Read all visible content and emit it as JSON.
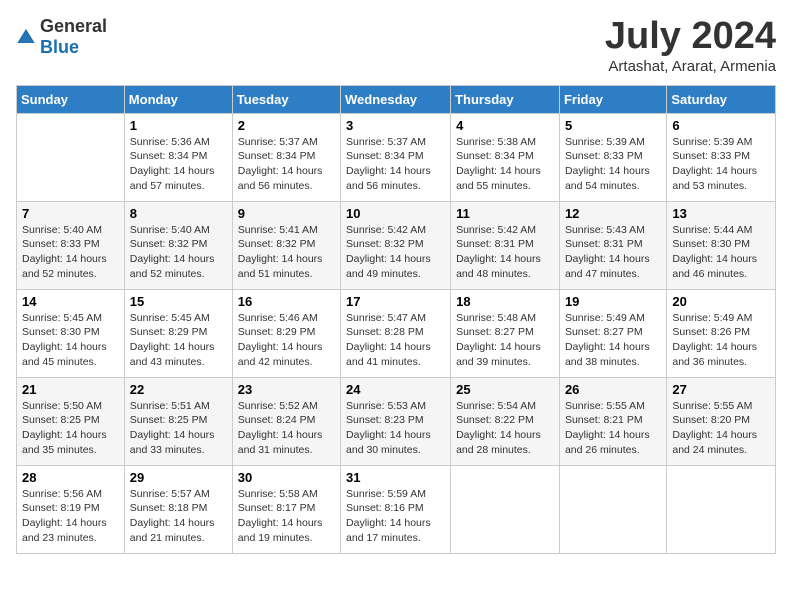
{
  "header": {
    "logo_general": "General",
    "logo_blue": "Blue",
    "month_title": "July 2024",
    "location": "Artashat, Ararat, Armenia"
  },
  "weekdays": [
    "Sunday",
    "Monday",
    "Tuesday",
    "Wednesday",
    "Thursday",
    "Friday",
    "Saturday"
  ],
  "weeks": [
    [
      {
        "day": "",
        "detail": ""
      },
      {
        "day": "1",
        "detail": "Sunrise: 5:36 AM\nSunset: 8:34 PM\nDaylight: 14 hours\nand 57 minutes."
      },
      {
        "day": "2",
        "detail": "Sunrise: 5:37 AM\nSunset: 8:34 PM\nDaylight: 14 hours\nand 56 minutes."
      },
      {
        "day": "3",
        "detail": "Sunrise: 5:37 AM\nSunset: 8:34 PM\nDaylight: 14 hours\nand 56 minutes."
      },
      {
        "day": "4",
        "detail": "Sunrise: 5:38 AM\nSunset: 8:34 PM\nDaylight: 14 hours\nand 55 minutes."
      },
      {
        "day": "5",
        "detail": "Sunrise: 5:39 AM\nSunset: 8:33 PM\nDaylight: 14 hours\nand 54 minutes."
      },
      {
        "day": "6",
        "detail": "Sunrise: 5:39 AM\nSunset: 8:33 PM\nDaylight: 14 hours\nand 53 minutes."
      }
    ],
    [
      {
        "day": "7",
        "detail": "Sunrise: 5:40 AM\nSunset: 8:33 PM\nDaylight: 14 hours\nand 52 minutes."
      },
      {
        "day": "8",
        "detail": "Sunrise: 5:40 AM\nSunset: 8:32 PM\nDaylight: 14 hours\nand 52 minutes."
      },
      {
        "day": "9",
        "detail": "Sunrise: 5:41 AM\nSunset: 8:32 PM\nDaylight: 14 hours\nand 51 minutes."
      },
      {
        "day": "10",
        "detail": "Sunrise: 5:42 AM\nSunset: 8:32 PM\nDaylight: 14 hours\nand 49 minutes."
      },
      {
        "day": "11",
        "detail": "Sunrise: 5:42 AM\nSunset: 8:31 PM\nDaylight: 14 hours\nand 48 minutes."
      },
      {
        "day": "12",
        "detail": "Sunrise: 5:43 AM\nSunset: 8:31 PM\nDaylight: 14 hours\nand 47 minutes."
      },
      {
        "day": "13",
        "detail": "Sunrise: 5:44 AM\nSunset: 8:30 PM\nDaylight: 14 hours\nand 46 minutes."
      }
    ],
    [
      {
        "day": "14",
        "detail": "Sunrise: 5:45 AM\nSunset: 8:30 PM\nDaylight: 14 hours\nand 45 minutes."
      },
      {
        "day": "15",
        "detail": "Sunrise: 5:45 AM\nSunset: 8:29 PM\nDaylight: 14 hours\nand 43 minutes."
      },
      {
        "day": "16",
        "detail": "Sunrise: 5:46 AM\nSunset: 8:29 PM\nDaylight: 14 hours\nand 42 minutes."
      },
      {
        "day": "17",
        "detail": "Sunrise: 5:47 AM\nSunset: 8:28 PM\nDaylight: 14 hours\nand 41 minutes."
      },
      {
        "day": "18",
        "detail": "Sunrise: 5:48 AM\nSunset: 8:27 PM\nDaylight: 14 hours\nand 39 minutes."
      },
      {
        "day": "19",
        "detail": "Sunrise: 5:49 AM\nSunset: 8:27 PM\nDaylight: 14 hours\nand 38 minutes."
      },
      {
        "day": "20",
        "detail": "Sunrise: 5:49 AM\nSunset: 8:26 PM\nDaylight: 14 hours\nand 36 minutes."
      }
    ],
    [
      {
        "day": "21",
        "detail": "Sunrise: 5:50 AM\nSunset: 8:25 PM\nDaylight: 14 hours\nand 35 minutes."
      },
      {
        "day": "22",
        "detail": "Sunrise: 5:51 AM\nSunset: 8:25 PM\nDaylight: 14 hours\nand 33 minutes."
      },
      {
        "day": "23",
        "detail": "Sunrise: 5:52 AM\nSunset: 8:24 PM\nDaylight: 14 hours\nand 31 minutes."
      },
      {
        "day": "24",
        "detail": "Sunrise: 5:53 AM\nSunset: 8:23 PM\nDaylight: 14 hours\nand 30 minutes."
      },
      {
        "day": "25",
        "detail": "Sunrise: 5:54 AM\nSunset: 8:22 PM\nDaylight: 14 hours\nand 28 minutes."
      },
      {
        "day": "26",
        "detail": "Sunrise: 5:55 AM\nSunset: 8:21 PM\nDaylight: 14 hours\nand 26 minutes."
      },
      {
        "day": "27",
        "detail": "Sunrise: 5:55 AM\nSunset: 8:20 PM\nDaylight: 14 hours\nand 24 minutes."
      }
    ],
    [
      {
        "day": "28",
        "detail": "Sunrise: 5:56 AM\nSunset: 8:19 PM\nDaylight: 14 hours\nand 23 minutes."
      },
      {
        "day": "29",
        "detail": "Sunrise: 5:57 AM\nSunset: 8:18 PM\nDaylight: 14 hours\nand 21 minutes."
      },
      {
        "day": "30",
        "detail": "Sunrise: 5:58 AM\nSunset: 8:17 PM\nDaylight: 14 hours\nand 19 minutes."
      },
      {
        "day": "31",
        "detail": "Sunrise: 5:59 AM\nSunset: 8:16 PM\nDaylight: 14 hours\nand 17 minutes."
      },
      {
        "day": "",
        "detail": ""
      },
      {
        "day": "",
        "detail": ""
      },
      {
        "day": "",
        "detail": ""
      }
    ]
  ]
}
